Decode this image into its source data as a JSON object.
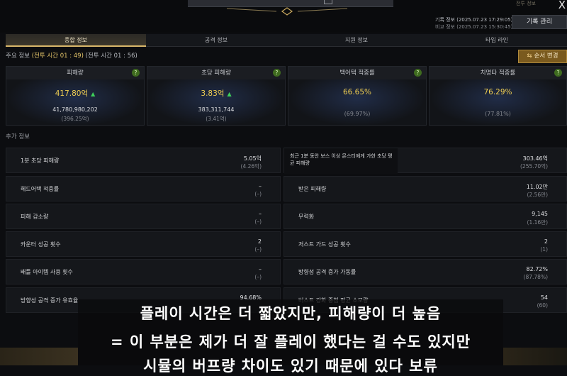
{
  "window": {
    "close_glyph": "X",
    "faint_top_text": "전투 정보",
    "record_info": "기록 정보 (2025.07.23 17:29:05)",
    "compare_info": "비교 정보 (2025.07.23 15:30:45)",
    "manage_button": "기록 관리"
  },
  "tabs": [
    {
      "label": "종합 정보",
      "active": true
    },
    {
      "label": "공격 정보",
      "active": false
    },
    {
      "label": "지원 정보",
      "active": false
    },
    {
      "label": "타임 라인",
      "active": false
    }
  ],
  "summary": {
    "label": "주요 정보",
    "battle_time_current": "(전투 시간 01 : 49)",
    "battle_time_compare": "(전투 시간 01 : 56)",
    "order_button": "순서 변경",
    "order_icon": "swap-icon"
  },
  "cards": [
    {
      "title": "피해량",
      "value": "417.80억",
      "trend": "▲",
      "detail": "41,780,980,202",
      "compare": "(396.25억)"
    },
    {
      "title": "초당 피해량",
      "value": "3.83억",
      "trend": "▲",
      "detail": "383,311,744",
      "compare": "(3.41억)"
    },
    {
      "title": "백어택 적중률",
      "value": "66.65%",
      "trend": "",
      "detail": "",
      "compare": "(69.97%)"
    },
    {
      "title": "치명타 적중률",
      "value": "76.29%",
      "trend": "",
      "detail": "",
      "compare": "(77.81%)"
    }
  ],
  "help_glyph": "?",
  "extra": {
    "label": "추가 정보",
    "left": [
      {
        "label": "1분 초당 피해량",
        "value": "5.05억",
        "compare": "(4.26억)"
      },
      {
        "label": "헤드어택 적중률",
        "value": "–",
        "compare": "(–)"
      },
      {
        "label": "피해 감소량",
        "value": "–",
        "compare": "(–)"
      },
      {
        "label": "카운터 성공 횟수",
        "value": "2",
        "compare": "(–)"
      },
      {
        "label": "배틀 아이템 사용 횟수",
        "value": "–",
        "compare": "(–)"
      },
      {
        "label": "방향성 공격 증가 유효율",
        "value": "94.68%",
        "compare": ""
      }
    ],
    "right": [
      {
        "label": "최근 1분 동안 보스 이상 몬스터에게 가한 초당 평균 피해량",
        "value": "303.46억",
        "compare": "(255.70억)"
      },
      {
        "label": "받은 피해량",
        "value": "11.02만",
        "compare": "(2.56만)"
      },
      {
        "label": "무력화",
        "value": "9,145",
        "compare": "(1.16만)"
      },
      {
        "label": "저스트 가드 성공 횟수",
        "value": "2",
        "compare": "(1)"
      },
      {
        "label": "방향성 공격 증가 가동률",
        "value": "82.72%",
        "compare": "(87.78%)"
      },
      {
        "label": "버스트 강화 중첩 평균 소모량",
        "value": "54",
        "compare": "(60)"
      }
    ]
  },
  "subtitles": [
    "플레이 시간은 더 짧았지만, 피해량이 더 높음",
    "= 이 부분은 제가 더 잘 플레이 했다는 걸 수도 있지만",
    "시뮬의 버프량 차이도 있기 때문에 있다 보류"
  ]
}
